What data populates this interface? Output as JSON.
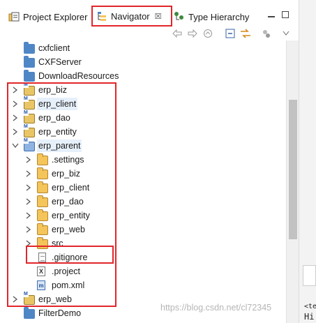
{
  "tabs": [
    {
      "label": "Project Explorer",
      "icon": "project-explorer-icon",
      "active": false
    },
    {
      "label": "Navigator",
      "icon": "navigator-icon",
      "active": true,
      "close": "☒"
    },
    {
      "label": "Type Hierarchy",
      "icon": "type-hierarchy-icon",
      "active": false
    }
  ],
  "toolbar": {
    "buttons": [
      "back-icon",
      "forward-icon",
      "home-icon",
      "collapse-all-icon",
      "link-editor-icon",
      "filters-icon",
      "view-menu-icon"
    ]
  },
  "tree": [
    {
      "label": "cxfclient",
      "icon": "folder-icon",
      "expanded": null,
      "depth": 0
    },
    {
      "label": "CXFServer",
      "icon": "folder-icon",
      "expanded": null,
      "depth": 0
    },
    {
      "label": "DownloadResources",
      "icon": "folder-icon",
      "expanded": null,
      "depth": 0
    },
    {
      "label": "erp_biz",
      "icon": "maven-project-icon",
      "expanded": false,
      "depth": 0
    },
    {
      "label": "erp_client",
      "icon": "maven-project-icon",
      "expanded": false,
      "depth": 0,
      "selected": true
    },
    {
      "label": "erp_dao",
      "icon": "maven-project-icon",
      "expanded": false,
      "depth": 0
    },
    {
      "label": "erp_entity",
      "icon": "maven-project-icon",
      "expanded": false,
      "depth": 0
    },
    {
      "label": "erp_parent",
      "icon": "maven-project-icon",
      "expanded": true,
      "depth": 0,
      "selected": true
    },
    {
      "label": ".settings",
      "icon": "folder-icon",
      "expanded": false,
      "depth": 1
    },
    {
      "label": "erp_biz",
      "icon": "folder-icon",
      "expanded": false,
      "depth": 1
    },
    {
      "label": "erp_client",
      "icon": "folder-icon",
      "expanded": false,
      "depth": 1
    },
    {
      "label": "erp_dao",
      "icon": "folder-icon",
      "expanded": false,
      "depth": 1
    },
    {
      "label": "erp_entity",
      "icon": "folder-icon",
      "expanded": false,
      "depth": 1
    },
    {
      "label": "erp_web",
      "icon": "folder-icon",
      "expanded": false,
      "depth": 1
    },
    {
      "label": "src",
      "icon": "folder-icon",
      "expanded": false,
      "depth": 1
    },
    {
      "label": ".gitignore",
      "icon": "file-icon",
      "expanded": null,
      "depth": 1
    },
    {
      "label": ".project",
      "icon": "xml-file-icon",
      "expanded": null,
      "depth": 1
    },
    {
      "label": "pom.xml",
      "icon": "pom-file-icon",
      "expanded": null,
      "depth": 1
    },
    {
      "label": "erp_web",
      "icon": "maven-project-icon",
      "expanded": false,
      "depth": 0
    },
    {
      "label": "FilterDemo",
      "icon": "folder-icon",
      "expanded": null,
      "depth": 0
    }
  ],
  "watermark": "https://blog.csdn.net/cl72345",
  "edge": {
    "text1": "<te",
    "text2": "Hi"
  }
}
